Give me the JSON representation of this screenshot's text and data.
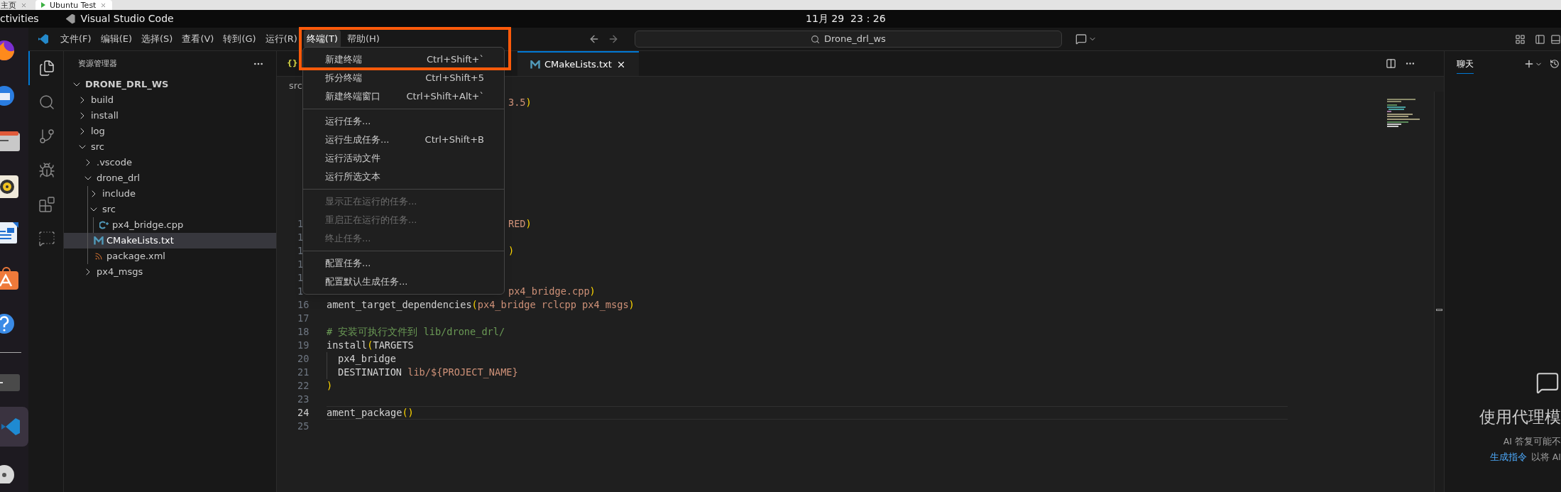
{
  "browser_tabs": [
    {
      "label": "主页",
      "selected": false
    },
    {
      "label": "Ubuntu Test",
      "selected": true
    }
  ],
  "top_bar": {
    "activities": "ctivities",
    "app": "Visual Studio Code",
    "clock": "11月 29  23：26"
  },
  "dock": [
    {
      "kind": "browser",
      "selected": false
    },
    {
      "kind": "mail",
      "selected": false
    },
    {
      "kind": "files",
      "selected": false
    },
    {
      "kind": "audio",
      "selected": false
    },
    {
      "kind": "writer",
      "selected": false
    },
    {
      "kind": "store",
      "selected": false
    },
    {
      "kind": "help",
      "selected": false
    },
    {
      "kind": "terminal",
      "selected": false
    },
    {
      "kind": "code",
      "selected": true
    },
    {
      "kind": "disc",
      "selected": false
    }
  ],
  "menu_bar": [
    {
      "label": "文件(F)",
      "selected": false
    },
    {
      "label": "编辑(E)",
      "selected": false
    },
    {
      "label": "选择(S)",
      "selected": false
    },
    {
      "label": "查看(V)",
      "selected": false
    },
    {
      "label": "转到(G)",
      "selected": false
    },
    {
      "label": "运行(R)",
      "selected": false
    },
    {
      "label": "终端(T)",
      "selected": true
    },
    {
      "label": "帮助(H)",
      "selected": false
    }
  ],
  "command_center": {
    "text": "Drone_drl_ws"
  },
  "activity_bar": [
    {
      "kind": "explorer",
      "selected": true
    },
    {
      "kind": "search",
      "selected": false
    },
    {
      "kind": "source-control",
      "selected": false
    },
    {
      "kind": "run",
      "selected": false
    },
    {
      "kind": "extensions",
      "selected": false
    },
    {
      "kind": "chat",
      "selected": false
    }
  ],
  "explorer": {
    "title": "资源管理器",
    "root": {
      "label": "DRONE_DRL_WS",
      "kind": "folder",
      "expanded": true,
      "selected": false,
      "children": [
        {
          "label": "build",
          "kind": "folder",
          "expanded": false,
          "selected": false
        },
        {
          "label": "install",
          "kind": "folder",
          "expanded": false,
          "selected": false
        },
        {
          "label": "log",
          "kind": "folder",
          "expanded": false,
          "selected": false
        },
        {
          "label": "src",
          "kind": "folder",
          "expanded": true,
          "selected": false,
          "children": [
            {
              "label": ".vscode",
              "kind": "folder",
              "expanded": false,
              "selected": false
            },
            {
              "label": "drone_drl",
              "kind": "folder",
              "expanded": true,
              "selected": false,
              "children": [
                {
                  "label": "include",
                  "kind": "folder",
                  "expanded": false,
                  "selected": false
                },
                {
                  "label": "src",
                  "kind": "folder",
                  "expanded": true,
                  "selected": false,
                  "children": [
                    {
                      "label": "px4_bridge.cpp",
                      "kind": "cpp",
                      "selected": false
                    }
                  ]
                },
                {
                  "label": "CMakeLists.txt",
                  "kind": "cmake",
                  "selected": true
                },
                {
                  "label": "package.xml",
                  "kind": "xml",
                  "selected": false
                }
              ]
            },
            {
              "label": "px4_msgs",
              "kind": "folder",
              "expanded": false,
              "selected": false
            }
          ]
        }
      ]
    }
  },
  "editor": {
    "tabs": [
      {
        "icon": "{}",
        "selected": false
      },
      {
        "label": "CMakeLists.txt",
        "kind": "cmake",
        "selected": true
      }
    ],
    "breadcrumb": "src",
    "lines": [
      {
        "covered": true,
        "current": false,
        "segments": [
          {
            "kind": "arg",
            "text": "3.5"
          },
          {
            "kind": "paren",
            "text": ")"
          }
        ]
      },
      {
        "current": false
      },
      {
        "current": false
      },
      {
        "current": false
      },
      {
        "current": false
      },
      {
        "current": false
      },
      {
        "current": false
      },
      {
        "current": false
      },
      {
        "current": false
      },
      {
        "covered": true,
        "current": false,
        "number": "1",
        "segments": [
          {
            "kind": "arg",
            "text": "RED"
          },
          {
            "kind": "paren",
            "text": ")"
          }
        ]
      },
      {
        "current": false,
        "number": "1"
      },
      {
        "covered": true,
        "current": false,
        "number": "1",
        "segments": [
          {
            "kind": "paren",
            "text": ")"
          }
        ]
      },
      {
        "current": false,
        "number": "1"
      },
      {
        "current": false,
        "number": "1"
      },
      {
        "covered": true,
        "current": false,
        "number": "1",
        "segments": [
          {
            "kind": "arg",
            "text": "px4_bridge.cpp"
          },
          {
            "kind": "paren",
            "text": ")"
          }
        ]
      },
      {
        "current": false,
        "number": "16",
        "segments": [
          {
            "kind": "plain",
            "text": "ament_target_dependencies"
          },
          {
            "kind": "paren",
            "text": "("
          },
          {
            "kind": "arg",
            "text": "px4_bridge rclcpp px4_msgs"
          },
          {
            "kind": "paren",
            "text": ")"
          }
        ]
      },
      {
        "current": false,
        "number": "17"
      },
      {
        "current": false,
        "number": "18",
        "segments": [
          {
            "kind": "comment",
            "text": "# 安装可执行文件到 lib/drone_drl/"
          }
        ]
      },
      {
        "current": false,
        "number": "19",
        "segments": [
          {
            "kind": "plain",
            "text": "install"
          },
          {
            "kind": "paren",
            "text": "("
          },
          {
            "kind": "plain",
            "text": "TARGETS"
          }
        ]
      },
      {
        "current": false,
        "number": "20",
        "indent": true,
        "segments": [
          {
            "kind": "plain",
            "text": "px4_bridge"
          }
        ]
      },
      {
        "current": false,
        "number": "21",
        "indent": true,
        "segments": [
          {
            "kind": "plain",
            "text": "DESTINATION "
          },
          {
            "kind": "arg",
            "text": "lib/${PROJECT_NAME}"
          }
        ]
      },
      {
        "current": false,
        "number": "22",
        "segments": [
          {
            "kind": "paren",
            "text": ")"
          }
        ]
      },
      {
        "current": false,
        "number": "23"
      },
      {
        "current": true,
        "number": "24",
        "segments": [
          {
            "kind": "plain",
            "text": "ament_package"
          },
          {
            "kind": "paren",
            "text": "()"
          }
        ]
      },
      {
        "current": false,
        "number": "25"
      }
    ]
  },
  "terminal_menu": {
    "sections": [
      [
        {
          "label": "新建终端",
          "shortcut": "Ctrl+Shift+`",
          "disabled": false
        },
        {
          "label": "拆分终端",
          "shortcut": "Ctrl+Shift+5",
          "disabled": false
        },
        {
          "label": "新建终端窗口",
          "shortcut": "Ctrl+Shift+Alt+`",
          "disabled": false
        }
      ],
      [
        {
          "label": "运行任务...",
          "disabled": false
        },
        {
          "label": "运行生成任务...",
          "shortcut": "Ctrl+Shift+B",
          "disabled": false
        },
        {
          "label": "运行活动文件",
          "disabled": false
        },
        {
          "label": "运行所选文本",
          "disabled": false
        }
      ],
      [
        {
          "label": "显示正在运行的任务...",
          "disabled": true
        },
        {
          "label": "重启正在运行的任务...",
          "disabled": true
        },
        {
          "label": "终止任务...",
          "disabled": true
        }
      ],
      [
        {
          "label": "配置任务...",
          "disabled": false
        },
        {
          "label": "配置默认生成任务...",
          "disabled": false
        }
      ]
    ]
  },
  "annotation": {
    "kind": "frame"
  },
  "chat": {
    "tab": {
      "label": "聊天",
      "selected": true
    },
    "title": "使用代理模",
    "note": "AI 答复可能不",
    "link": "生成指令",
    "link_tail": "以将 AI"
  }
}
